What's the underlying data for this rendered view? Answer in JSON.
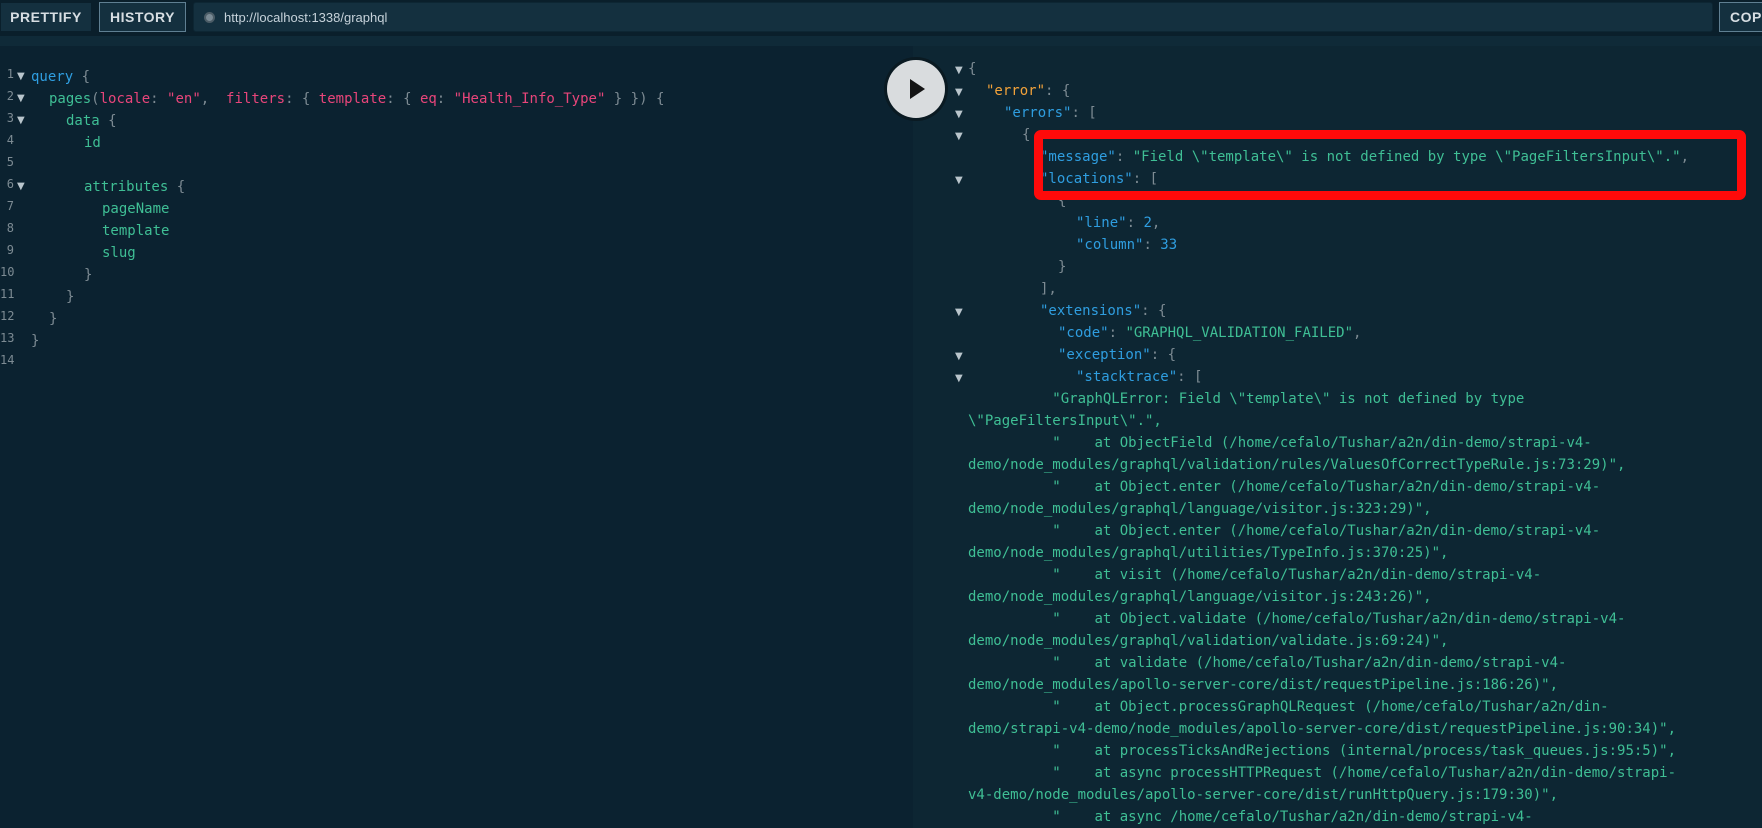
{
  "toolbar": {
    "prettify_label": "PRETTIFY",
    "history_label": "HISTORY",
    "url": "http://localhost:1338/graphql",
    "copy_label": "COP"
  },
  "editor": {
    "line_numbers": [
      "1",
      "2",
      "3",
      "4",
      "5",
      "6",
      "7",
      "8",
      "9",
      "10",
      "11",
      "12",
      "13",
      "14"
    ],
    "lines": {
      "l1": {
        "kw": "query",
        "brace": " {"
      },
      "l2": {
        "fn": "pages",
        "p1": "(",
        "a1": "locale",
        "c1": ": ",
        "s1": "\"en\"",
        "c2": ",  ",
        "a2": "filters",
        "c3": ": { ",
        "a3": "template",
        "c4": ": { ",
        "a4": "eq",
        "c5": ": ",
        "s2": "\"Health_Info_Type\"",
        "c6": " } }) {"
      },
      "l3": {
        "fn": "data",
        "brace": " {"
      },
      "l4": {
        "fn": "id"
      },
      "l6": {
        "fn": "attributes",
        "brace": " {"
      },
      "l7": {
        "fn": "pageName"
      },
      "l8": {
        "fn": "template"
      },
      "l9": {
        "fn": "slug"
      },
      "l10": "}",
      "l11": "}",
      "l12": "}",
      "l13": "}"
    }
  },
  "result": {
    "r1": "{",
    "r2_key": "\"error\"",
    "r2_rest": ": {",
    "r3_key": "\"errors\"",
    "r3_rest": ": [",
    "r4": "{",
    "r5_key": "\"message\"",
    "r5_colon": ": ",
    "r5_val": "\"Field \\\"template\\\" is not defined by type \\\"PageFiltersInput\\\".\"",
    "r5_end": ",",
    "r6_key": "\"locations\"",
    "r6_rest": ": [",
    "r7": "{",
    "r8_key": "\"line\"",
    "r8_colon": ": ",
    "r8_val": "2",
    "r8_end": ",",
    "r9_key": "\"column\"",
    "r9_colon": ": ",
    "r9_val": "33",
    "r10": "}",
    "r11": "],",
    "r12_key": "\"extensions\"",
    "r12_rest": ": {",
    "r13_key": "\"code\"",
    "r13_colon": ": ",
    "r13_val": "\"GRAPHQL_VALIDATION_FAILED\"",
    "r13_end": ",",
    "r14_key": "\"exception\"",
    "r14_rest": ": {",
    "r15_key": "\"stacktrace\"",
    "r15_rest": ": [",
    "stack": [
      {
        "indent": "          ",
        "text": "\"GraphQLError: Field \\\"template\\\" is not defined by type"
      },
      {
        "indent": "",
        "text": "\\\"PageFiltersInput\\\".\","
      },
      {
        "indent": "          ",
        "text": "\"    at ObjectField (/home/cefalo/Tushar/a2n/din-demo/strapi-v4-"
      },
      {
        "indent": "",
        "text": "demo/node_modules/graphql/validation/rules/ValuesOfCorrectTypeRule.js:73:29)\","
      },
      {
        "indent": "          ",
        "text": "\"    at Object.enter (/home/cefalo/Tushar/a2n/din-demo/strapi-v4-"
      },
      {
        "indent": "",
        "text": "demo/node_modules/graphql/language/visitor.js:323:29)\","
      },
      {
        "indent": "          ",
        "text": "\"    at Object.enter (/home/cefalo/Tushar/a2n/din-demo/strapi-v4-"
      },
      {
        "indent": "",
        "text": "demo/node_modules/graphql/utilities/TypeInfo.js:370:25)\","
      },
      {
        "indent": "          ",
        "text": "\"    at visit (/home/cefalo/Tushar/a2n/din-demo/strapi-v4-"
      },
      {
        "indent": "",
        "text": "demo/node_modules/graphql/language/visitor.js:243:26)\","
      },
      {
        "indent": "          ",
        "text": "\"    at Object.validate (/home/cefalo/Tushar/a2n/din-demo/strapi-v4-"
      },
      {
        "indent": "",
        "text": "demo/node_modules/graphql/validation/validate.js:69:24)\","
      },
      {
        "indent": "          ",
        "text": "\"    at validate (/home/cefalo/Tushar/a2n/din-demo/strapi-v4-"
      },
      {
        "indent": "",
        "text": "demo/node_modules/apollo-server-core/dist/requestPipeline.js:186:26)\","
      },
      {
        "indent": "          ",
        "text": "\"    at Object.processGraphQLRequest (/home/cefalo/Tushar/a2n/din-"
      },
      {
        "indent": "",
        "text": "demo/strapi-v4-demo/node_modules/apollo-server-core/dist/requestPipeline.js:90:34)\","
      },
      {
        "indent": "          ",
        "text": "\"    at processTicksAndRejections (internal/process/task_queues.js:95:5)\","
      },
      {
        "indent": "          ",
        "text": "\"    at async processHTTPRequest (/home/cefalo/Tushar/a2n/din-demo/strapi-"
      },
      {
        "indent": "",
        "text": "v4-demo/node_modules/apollo-server-core/dist/runHttpQuery.js:179:30)\","
      },
      {
        "indent": "          ",
        "text": "\"    at async /home/cefalo/Tushar/a2n/din-demo/strapi-v4-"
      }
    ]
  }
}
